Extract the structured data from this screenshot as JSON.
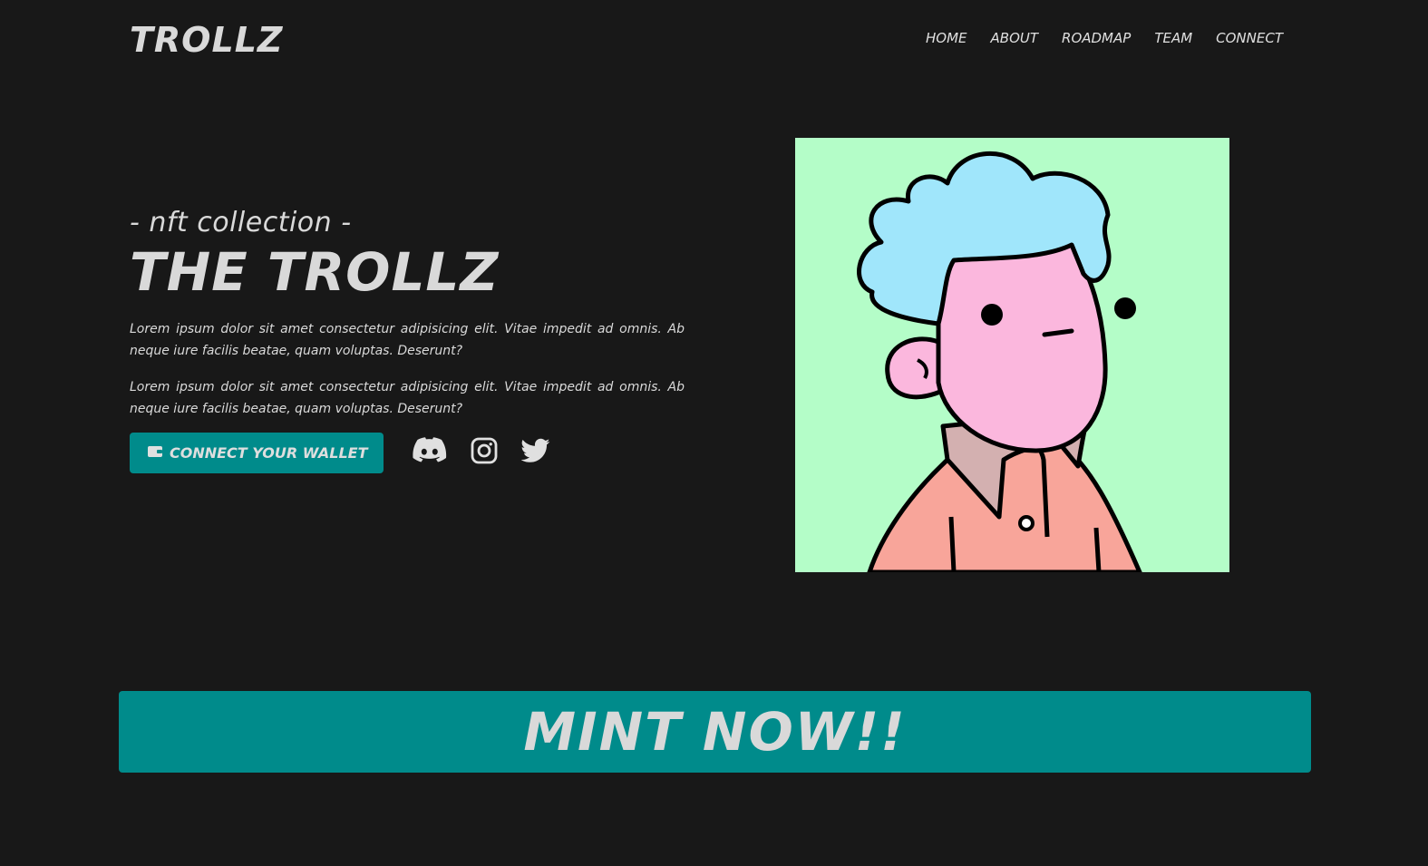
{
  "brand": "TROLLZ",
  "nav": {
    "items": [
      {
        "label": "HOME"
      },
      {
        "label": "ABOUT"
      },
      {
        "label": "ROADMAP"
      },
      {
        "label": "TEAM"
      },
      {
        "label": "CONNECT"
      }
    ]
  },
  "hero": {
    "subtitle": "- nft collection -",
    "title": "THE TROLLZ",
    "paragraphs": [
      "Lorem ipsum dolor sit amet consectetur adipisicing elit. Vitae impedit ad omnis. Ab neque iure facilis beatae, quam voluptas. Deserunt?",
      "Lorem ipsum dolor sit amet consectetur adipisicing elit. Vitae impedit ad omnis. Ab neque iure facilis beatae, quam voluptas. Deserunt?"
    ],
    "wallet_button": "CONNECT YOUR WALLET",
    "social": [
      "discord-icon",
      "instagram-icon",
      "twitter-icon"
    ],
    "image_background": "#b4fdc8"
  },
  "mint": {
    "label": "MINT NOW!!"
  },
  "colors": {
    "background": "#181818",
    "accent": "#008b8b",
    "text": "#d9d9d9"
  }
}
